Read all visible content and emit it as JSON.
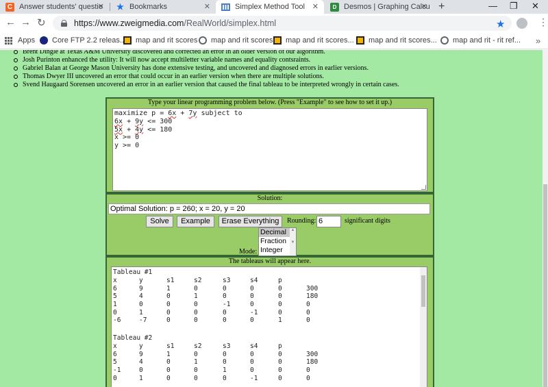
{
  "browser": {
    "tabs": [
      {
        "title": "Answer students' questio",
        "icon": "chegg-icon",
        "icon_color": "#f26522"
      },
      {
        "title": "Bookmarks",
        "icon": "star-icon",
        "icon_color": "#1a73e8"
      },
      {
        "title": "Simplex Method Tool",
        "icon": "site-icon",
        "icon_color": "#4a7fc1"
      },
      {
        "title": "Desmos | Graphing Calcu",
        "icon": "desmos-icon",
        "icon_color": "#2f8a3e"
      }
    ],
    "new_tab_glyph": "+",
    "url_host": "https://www.zweigmedia.com",
    "url_path": "/RealWorld/simplex.html",
    "bookmarks": [
      {
        "label": "Apps",
        "icon": "apps-grid-icon"
      },
      {
        "label": "Core FTP 2.2 releas...",
        "icon": "coreftp-icon"
      },
      {
        "label": "map and rit scores",
        "icon": "nwea-icon"
      },
      {
        "label": "map and rit scores",
        "icon": "globe-icon"
      },
      {
        "label": "map and rit scores...",
        "icon": "nwea-icon"
      },
      {
        "label": "map and rit scores...",
        "icon": "nwea-icon"
      },
      {
        "label": "map and rit - rit ref...",
        "icon": "globe-icon"
      }
    ],
    "colors": {
      "tab_bar": "#dee1e6",
      "accent": "#1a73e8",
      "nwea_icon": "#f4b400"
    }
  },
  "credits": [
    "Brent Dingle at Texas A&M University discovered and corrected an error in an older version of our algorithm.",
    "Josh Purinton enhanced the utility: It will now accept multiletter variable names and equality contsraints.",
    "Gabriel Balan at George Mason University has done extensive testing, and uncovered and diagnosed errors in earlier versions.",
    "Thomas Dwyer III uncovered an error that could occur in an earlier version when there are multiple solutions.",
    "Svend Haugaard Sorensen uncovered an error in an earlier version that caused the final tableau to be interpreted wrongly in certain cases."
  ],
  "problem": {
    "header": "Type your linear programming problem below. (Press \"Example\" to see how to set it up.)",
    "lines": [
      {
        "pre": "maximize p = ",
        "a": "6x",
        "mid": " + ",
        "b": "7y",
        "post": " subject to"
      },
      {
        "pre": "",
        "a": "6x",
        "mid": " + ",
        "b": "9y",
        "post": " <= 300"
      },
      {
        "pre": "",
        "a": "5x",
        "mid": " + ",
        "b": "4y",
        "post": " <= 180"
      },
      {
        "pre": "x >= 0",
        "a": "",
        "mid": "",
        "b": "",
        "post": ""
      },
      {
        "pre": "y >= 0",
        "a": "",
        "mid": "",
        "b": "",
        "post": ""
      }
    ]
  },
  "solution": {
    "header": "Solution:",
    "value": "Optimal Solution: p = 260; x = 20, y = 20",
    "solve_label": "Solve",
    "example_label": "Example",
    "erase_label": "Erase Everything",
    "rounding_label": "Rounding:",
    "rounding_value": "6",
    "significant_label": "significant digits",
    "mode_label": "Mode:",
    "mode_options": [
      "Decimal",
      "Fraction",
      "Integer"
    ],
    "mode_selected": "Decimal"
  },
  "tableaus": {
    "header": "The tableaus will appear here.",
    "items": [
      {
        "title": "Tableau #1",
        "rows": [
          [
            "x",
            "y",
            "s1",
            "s2",
            "s3",
            "s4",
            "p",
            ""
          ],
          [
            "6",
            "9",
            "1",
            "0",
            "0",
            "0",
            "0",
            "300"
          ],
          [
            "5",
            "4",
            "0",
            "1",
            "0",
            "0",
            "0",
            "180"
          ],
          [
            "1",
            "0",
            "0",
            "0",
            "-1",
            "0",
            "0",
            "0"
          ],
          [
            "0",
            "1",
            "0",
            "0",
            "0",
            "-1",
            "0",
            "0"
          ],
          [
            "-6",
            "-7",
            "0",
            "0",
            "0",
            "0",
            "1",
            "0"
          ]
        ]
      },
      {
        "title": "Tableau #2",
        "rows": [
          [
            "x",
            "y",
            "s1",
            "s2",
            "s3",
            "s4",
            "p",
            ""
          ],
          [
            "6",
            "9",
            "1",
            "0",
            "0",
            "0",
            "0",
            "300"
          ],
          [
            "5",
            "4",
            "0",
            "1",
            "0",
            "0",
            "0",
            "180"
          ],
          [
            "-1",
            "0",
            "0",
            "0",
            "1",
            "0",
            "0",
            "0"
          ],
          [
            "0",
            "1",
            "0",
            "0",
            "0",
            "-1",
            "0",
            "0"
          ]
        ]
      }
    ]
  }
}
